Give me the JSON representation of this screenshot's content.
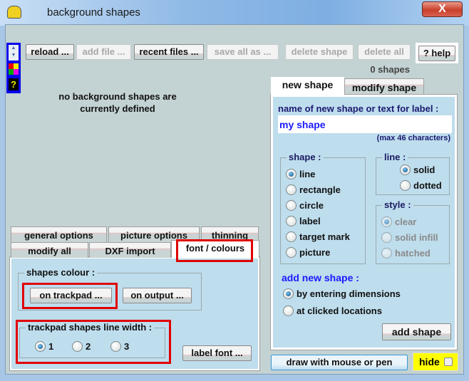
{
  "window": {
    "title": "background shapes",
    "close_label": "X"
  },
  "toolbar": {
    "reload": "reload ...",
    "add_file": "add file ...",
    "recent_files": "recent files ...",
    "save_all_as": "save all as ...",
    "delete_shape": "delete shape",
    "delete_all": "delete all",
    "help": "? help"
  },
  "side_strip": {
    "help_label": "?"
  },
  "shape_count": "0 shapes",
  "empty_message": {
    "line1": "no background shapes are",
    "line2": "currently defined"
  },
  "left_tabs": {
    "row1": [
      "general options",
      "picture options",
      "thinning"
    ],
    "row2": [
      "modify all",
      "DXF import",
      "font / colours"
    ],
    "active": "font / colours"
  },
  "font_colours": {
    "shapes_colour_label": "shapes colour :",
    "on_trackpad": "on trackpad ...",
    "on_output": "on output ...",
    "line_width_label": "trackpad shapes line width :",
    "line_widths": [
      "1",
      "2",
      "3"
    ],
    "selected_width": "1",
    "label_font": "label font ..."
  },
  "right_tabs": {
    "new_shape": "new shape",
    "modify_shape": "modify shape",
    "active": "new shape"
  },
  "new_shape": {
    "name_label": "name of new shape or text for label :",
    "name_value": "my shape",
    "max_chars": "(max 46 characters)",
    "shape_label": "shape :",
    "shapes": [
      "line",
      "rectangle",
      "circle",
      "label",
      "target mark",
      "picture"
    ],
    "selected_shape": "line",
    "line_label": "line :",
    "line_options": [
      "solid",
      "dotted"
    ],
    "selected_line": "solid",
    "style_label": "style :",
    "style_options": [
      "clear",
      "solid infill",
      "hatched"
    ],
    "selected_style": "clear",
    "add_label": "add new shape :",
    "add_options": [
      "by entering dimensions",
      "at clicked locations"
    ],
    "selected_add": "by entering dimensions",
    "add_button": "add shape"
  },
  "bottom": {
    "draw_button": "draw with mouse or pen",
    "hide_label": "hide"
  },
  "colors": {
    "highlight_red": "#e00000",
    "panel_blue": "#bedded",
    "hide_yellow": "#ffff00",
    "accent_blue": "#1a1aff"
  }
}
